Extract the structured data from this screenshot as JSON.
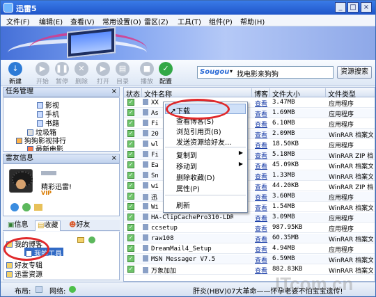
{
  "window": {
    "title": "迅雷5",
    "controls": [
      "_",
      "□",
      "×"
    ]
  },
  "menu": [
    "文件(F)",
    "编辑(E)",
    "查看(V)",
    "常用设置(O)",
    "雷区(Z)",
    "工具(T)",
    "组件(P)",
    "帮助(H)"
  ],
  "toolbar": {
    "buttons": [
      {
        "label": "新建",
        "icon": "new-icon",
        "enabled": true,
        "color": "#2d7bd6"
      },
      {
        "label": "开始",
        "icon": "play-icon",
        "enabled": false
      },
      {
        "label": "暂停",
        "icon": "pause-icon",
        "enabled": false
      },
      {
        "label": "删除",
        "icon": "delete-icon",
        "enabled": false
      },
      {
        "label": "打开",
        "icon": "open-icon",
        "enabled": false
      },
      {
        "label": "目录",
        "icon": "folder-icon",
        "enabled": false
      },
      {
        "label": "播放",
        "icon": "media-play-icon",
        "enabled": false
      },
      {
        "label": "配置",
        "icon": "config-icon",
        "enabled": true,
        "color": "#33a847"
      }
    ]
  },
  "search": {
    "engine": "Sougou",
    "query": "找电影来狗狗",
    "button": "资源搜索"
  },
  "task_panel": {
    "header": "任务管理",
    "items": [
      {
        "label": "影视",
        "indent": 3
      },
      {
        "label": "手机",
        "indent": 3
      },
      {
        "label": "书籍",
        "indent": 3
      },
      {
        "label": "垃圾箱",
        "indent": 2
      },
      {
        "label": "狗狗影视排行",
        "indent": 1
      },
      {
        "label": "最新电影",
        "indent": 2
      }
    ]
  },
  "friend_panel": {
    "header": "雷友信息",
    "greeting": "精彩迅雷!",
    "badge": "VIP",
    "tabs": [
      "信息",
      "收藏",
      "好友"
    ],
    "tree": [
      {
        "label": "我的博客",
        "indent": 0
      },
      {
        "label": "我的工具",
        "indent": 1,
        "selected": true
      },
      {
        "label": "好友专辑",
        "indent": 0
      },
      {
        "label": "迅雷资源",
        "indent": 0
      }
    ]
  },
  "grid": {
    "columns": [
      "状态",
      "文件名称",
      "博客",
      "文件大小",
      "文件类型"
    ],
    "rows": [
      {
        "name": "XX",
        "blog": "查看",
        "size": "3.47MB",
        "type": "应用程序"
      },
      {
        "name": "As",
        "blog": "查看",
        "size": "1.69MB",
        "type": "应用程序"
      },
      {
        "name": "Fi",
        "blog": "查看",
        "size": "6.10MB",
        "type": "应用程序"
      },
      {
        "name": "20",
        "blog": "查看",
        "size": "2.09MB",
        "type": "WinRAR 档案文"
      },
      {
        "name": "wl",
        "blog": "查看",
        "size": "18.50KB",
        "type": "应用程序"
      },
      {
        "name": "Fi",
        "blog": "查看",
        "size": "5.18MB",
        "type": "WinRAR ZIP 档"
      },
      {
        "name": "Ea",
        "blog": "查看",
        "size": "45.09KB",
        "type": "WinRAR 档案文"
      },
      {
        "name": "Sn",
        "blog": "查看",
        "size": "1.33MB",
        "type": "WinRAR 档案文"
      },
      {
        "name": "wi",
        "blog": "查看",
        "size": "44.20KB",
        "type": "WinRAR ZIP 档"
      },
      {
        "name": "迅",
        "blog": "查看",
        "size": "3.60MB",
        "type": "应用程序"
      },
      {
        "name": "Wi",
        "blog": "查看",
        "size": "1.54MB",
        "type": "WinRAR 档案文"
      },
      {
        "name": "HA-ClipCachePro310-LDR",
        "blog": "查看",
        "size": "3.09MB",
        "type": "应用程序"
      },
      {
        "name": "ccsetup",
        "blog": "查看",
        "size": "987.95KB",
        "type": "应用程序"
      },
      {
        "name": "raw108",
        "blog": "查看",
        "size": "60.35MB",
        "type": "WinRAR 档案文"
      },
      {
        "name": "DreamMail4_Setup",
        "blog": "查看",
        "size": "4.94MB",
        "type": "应用程序"
      },
      {
        "name": "MSN Messager V7.5",
        "blog": "查看",
        "size": "6.59MB",
        "type": "WinRAR 档案文"
      },
      {
        "name": "万象加加",
        "blog": "查看",
        "size": "882.83KB",
        "type": "WinRAR 档案文"
      }
    ]
  },
  "context_menu": {
    "items": [
      {
        "label": "下载",
        "highlighted": true
      },
      {
        "label": "查看博客(S)"
      },
      {
        "label": "浏览引用页(B)"
      },
      {
        "label": "发送资源给好友..."
      },
      {
        "separator": true
      },
      {
        "label": "复制到",
        "submenu": true
      },
      {
        "label": "移动到",
        "submenu": true
      },
      {
        "label": "删除收藏(D)"
      },
      {
        "label": "属性(P)"
      },
      {
        "separator": true
      },
      {
        "label": "刷新"
      }
    ]
  },
  "status_bar": {
    "layout_label": "布局:",
    "network_label": "网络:",
    "ticker": "肝炎(HBV)07大革命——怀孕老婆不怕宝宝遗传!"
  },
  "watermark": "ITcom.cn",
  "colors": {
    "accent": "#2d7bd6",
    "highlight_oval": "#e0292b",
    "check_green": "#6ec46a"
  }
}
